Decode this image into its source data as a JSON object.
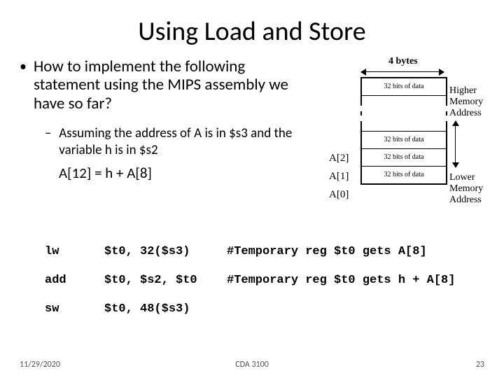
{
  "title": "Using Load and Store",
  "bullet": "How to implement the following statement using the MIPS assembly we have so far?",
  "sub": "Assuming the address of A is in $s3 and the variable h is in $s2",
  "equation": "A[12] = h + A[8]",
  "diagram": {
    "bytes_label": "4 bytes",
    "cell_top": "32 bits of data",
    "cell_a2": "32 bits of data",
    "cell_a1": "32 bits of data",
    "cell_a0": "32 bits of data",
    "idx_a2": "A[2]",
    "idx_a1": "A[1]",
    "idx_a0": "A[0]",
    "higher": "Higher Memory Address",
    "lower": "Lower Memory Address"
  },
  "code": [
    {
      "op": "lw",
      "args": "$t0, 32($s3)",
      "cmt": "#Temporary reg $t0 gets A[8]"
    },
    {
      "op": "add",
      "args": "$t0, $s2, $t0",
      "cmt": "#Temporary reg $t0 gets h + A[8]"
    },
    {
      "op": "sw",
      "args": "$t0, 48($s3)",
      "cmt": ""
    }
  ],
  "footer": {
    "date": "11/29/2020",
    "mid": "CDA 3100",
    "num": "23"
  }
}
